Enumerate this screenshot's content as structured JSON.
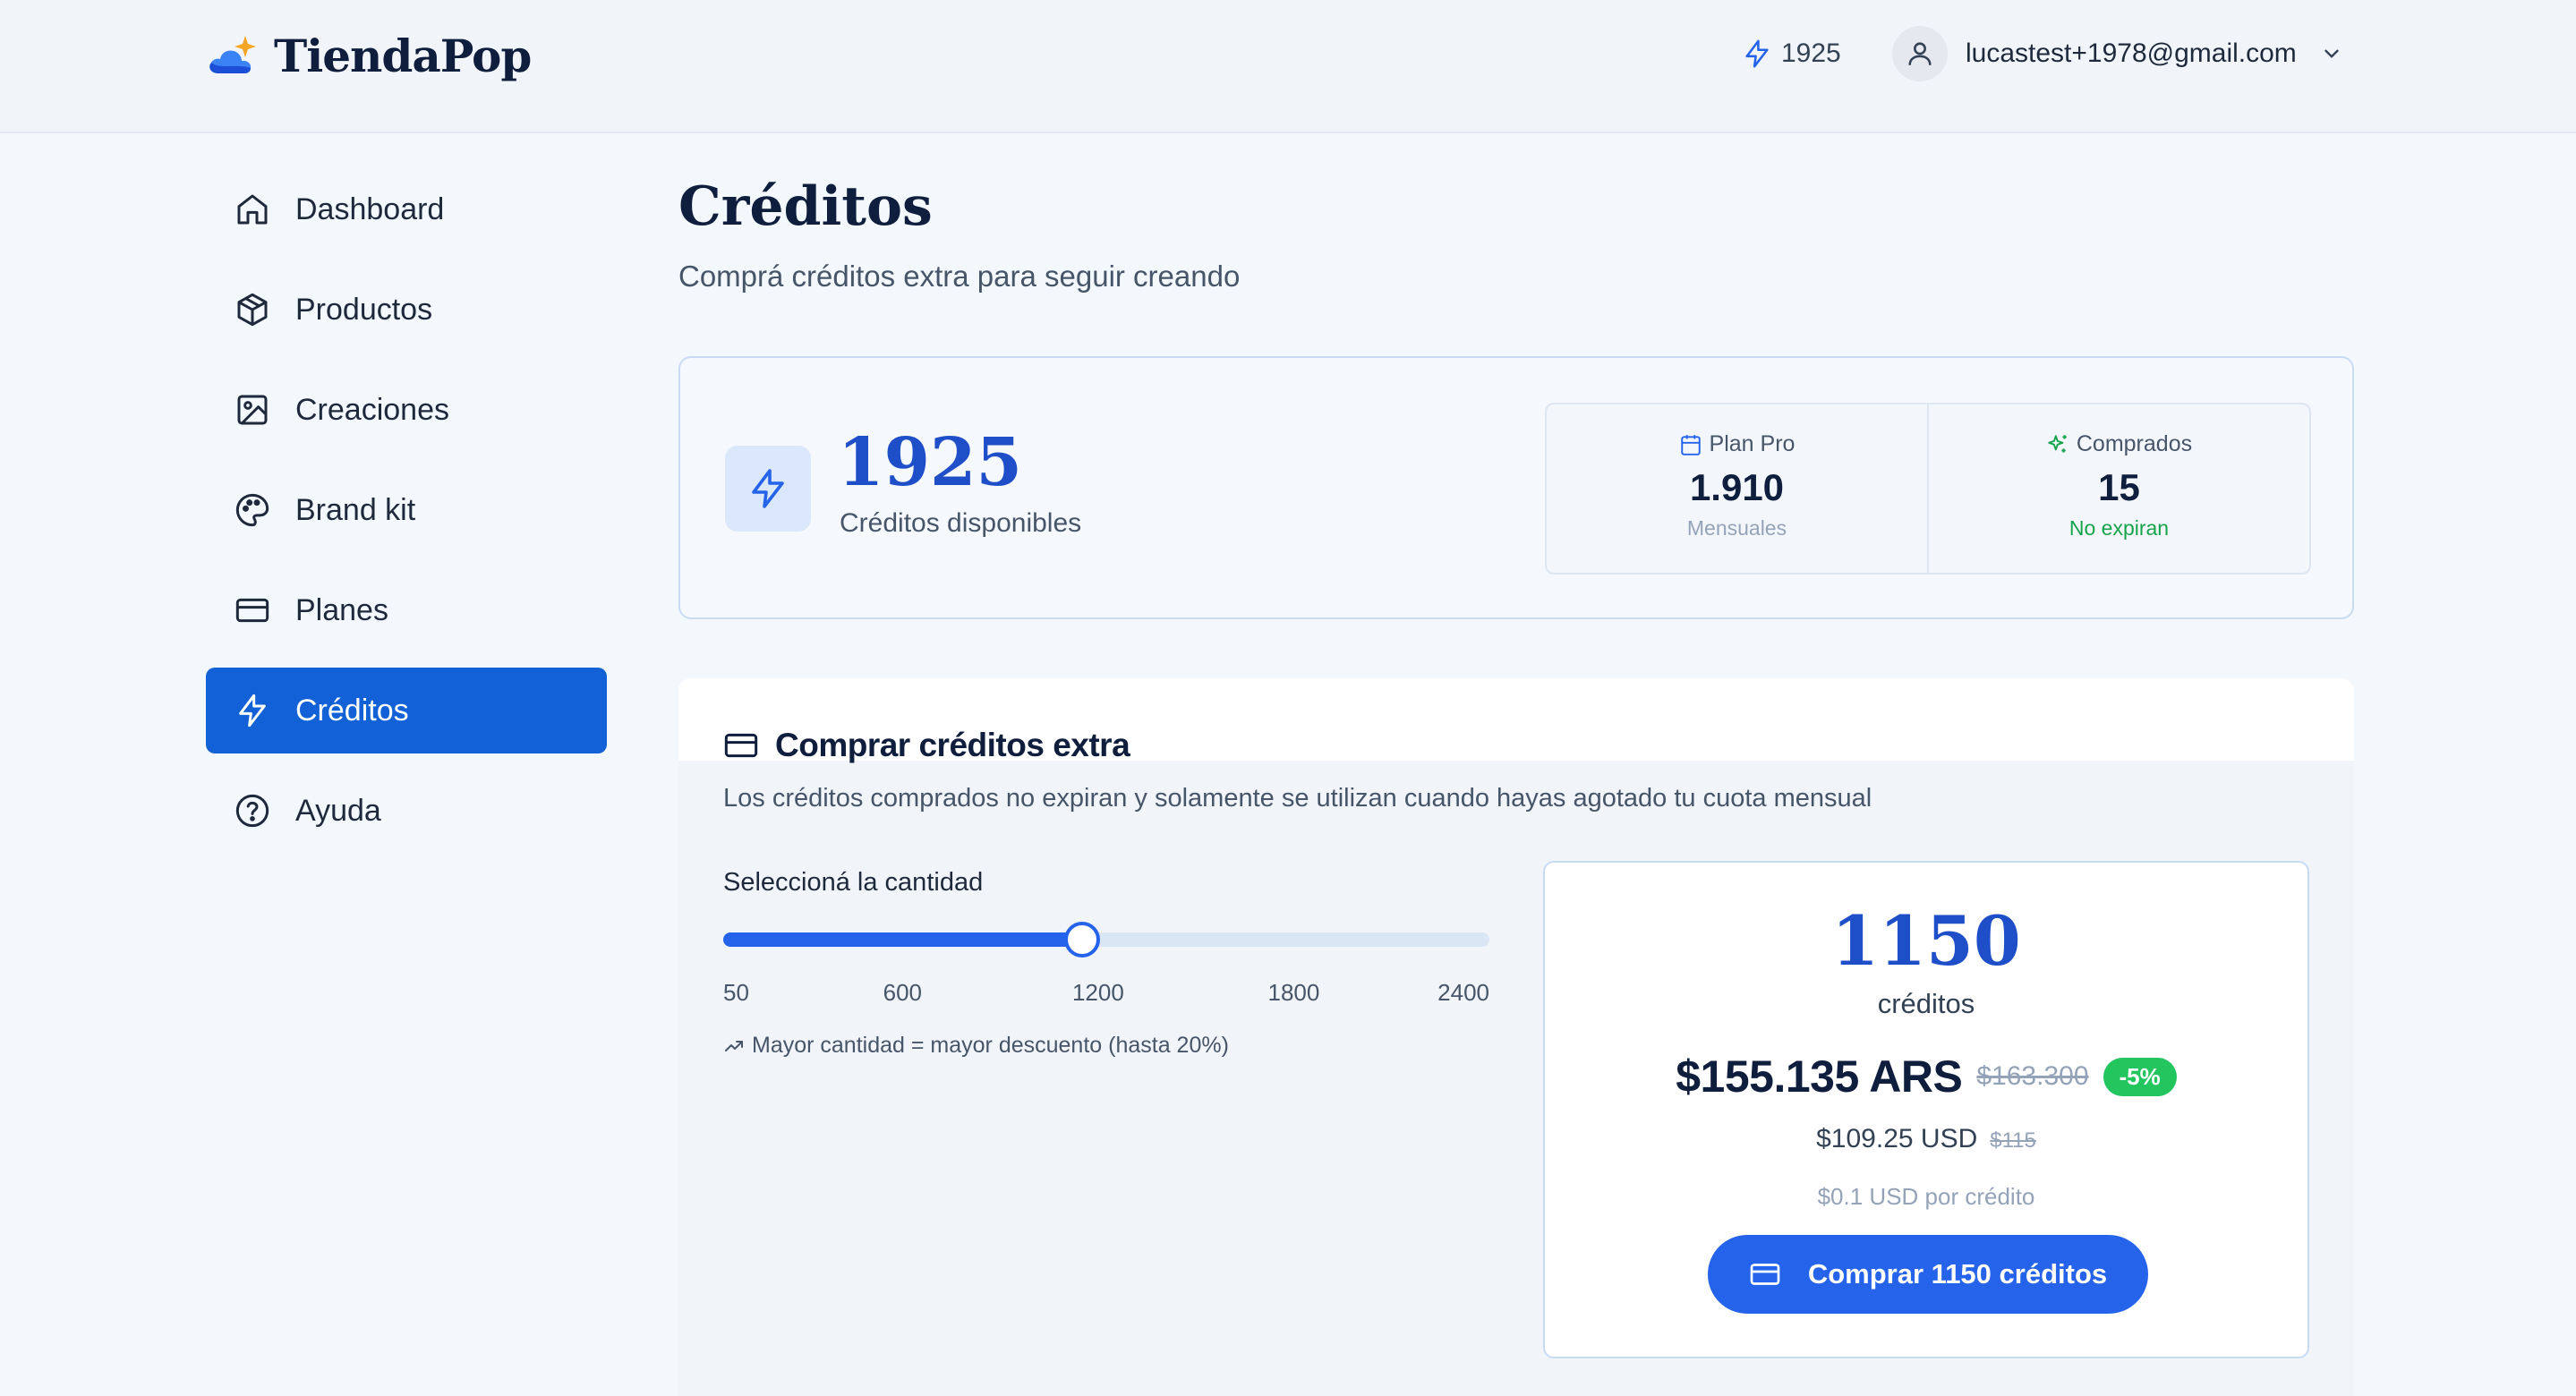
{
  "app": {
    "name": "TiendaPop"
  },
  "header": {
    "credits": "1925",
    "user_email": "lucastest+1978@gmail.com"
  },
  "sidebar": {
    "items": [
      {
        "label": "Dashboard",
        "icon": "home-icon",
        "active": false
      },
      {
        "label": "Productos",
        "icon": "box-icon",
        "active": false
      },
      {
        "label": "Creaciones",
        "icon": "image-icon",
        "active": false
      },
      {
        "label": "Brand kit",
        "icon": "palette-icon",
        "active": false
      },
      {
        "label": "Planes",
        "icon": "credit-card-icon",
        "active": false
      },
      {
        "label": "Créditos",
        "icon": "bolt-icon",
        "active": true
      },
      {
        "label": "Ayuda",
        "icon": "help-circle-icon",
        "active": false
      }
    ]
  },
  "page": {
    "title": "Créditos",
    "subtitle": "Comprá créditos extra para seguir creando"
  },
  "summary": {
    "available": "1925",
    "available_label": "Créditos disponibles",
    "plan": {
      "label": "Plan Pro",
      "value": "1.910",
      "note": "Mensuales"
    },
    "purchased": {
      "label": "Comprados",
      "value": "15",
      "note": "No expiran"
    }
  },
  "buy": {
    "title": "Comprar créditos extra",
    "description": "Los créditos comprados no expiran y solamente se utilizan cuando hayas agotado tu cuota mensual",
    "slider": {
      "label": "Seleccioná la cantidad",
      "min": 50,
      "max": 2400,
      "value": 1150,
      "tick_values": [
        50,
        600,
        1200,
        1800,
        2400
      ],
      "ticks": [
        "50",
        "600",
        "1200",
        "1800",
        "2400"
      ]
    },
    "hint": "Mayor cantidad = mayor descuento (hasta 20%)",
    "summary": {
      "amount": "1150",
      "unit": "créditos",
      "price": "$155.135 ARS",
      "old_price": "$163.300",
      "discount": "-5%",
      "usd": "$109.25 USD",
      "usd_old": "$115",
      "per_credit": "$0.1 USD por crédito",
      "button": "Comprar 1150 créditos"
    }
  },
  "colors": {
    "accent": "#2563eb",
    "sidebar_active": "#1261d6",
    "heading_number": "#1e4fc9",
    "success": "#22c55e"
  }
}
